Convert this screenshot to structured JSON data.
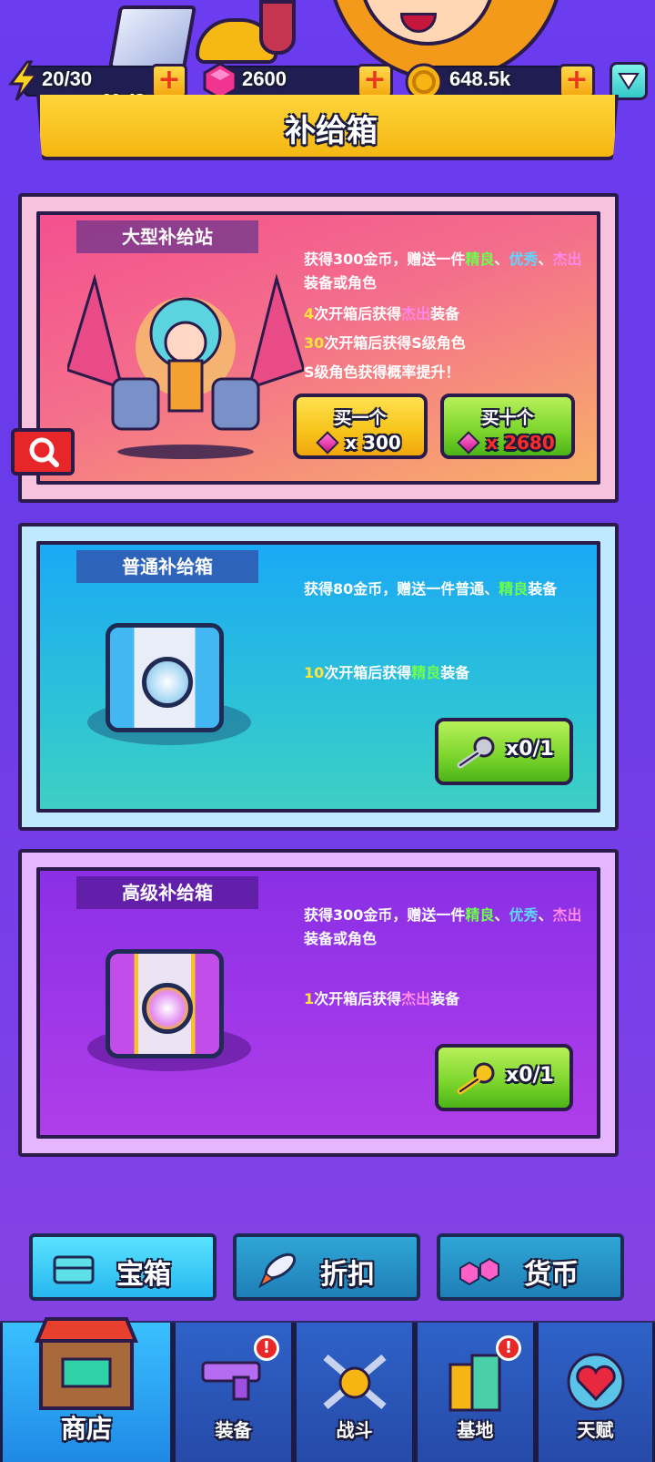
{
  "resources": {
    "energy": "20/30",
    "timer": "09:42",
    "gems": "2600",
    "coins": "648.5k",
    "plus_label": "+"
  },
  "header": {
    "title": "补给箱"
  },
  "cards": {
    "big": {
      "title": "大型补给站",
      "line1_a": "获得300金币，赠送一件",
      "line1_b": "精良",
      "line1_c": "、",
      "line1_d": "优秀",
      "line1_e": "、",
      "line1_f": "杰出",
      "line1_g": "装备或角色",
      "line2_a": "4",
      "line2_b": "次开箱后获得",
      "line2_c": "杰出",
      "line2_d": "装备",
      "line3_a": "30",
      "line3_b": "次开箱后获得S级角色",
      "line4": "S级角色获得概率提升！",
      "buy_one_label": "买一个",
      "buy_one_price": "x 300",
      "buy_ten_label": "买十个",
      "buy_ten_price": "x 2680"
    },
    "normal": {
      "title": "普通补给箱",
      "line1_a": "获得80金币，赠送一件普通、",
      "line1_b": "精良",
      "line1_c": "装备",
      "line2_a": "10",
      "line2_b": "次开箱后获得",
      "line2_c": "精良",
      "line2_d": "装备",
      "key_count": "x0/1"
    },
    "advanced": {
      "title": "高级补给箱",
      "line1_a": "获得300金币，赠送一件",
      "line1_b": "精良",
      "line1_c": "、",
      "line1_d": "优秀",
      "line1_e": "、",
      "line1_f": "杰出",
      "line1_g": "装备或角色",
      "line2_a": "1",
      "line2_b": "次开箱后获得",
      "line2_c": "杰出",
      "line2_d": "装备",
      "key_count": "x0/1"
    }
  },
  "sub_tabs": [
    {
      "label": "宝箱"
    },
    {
      "label": "折扣"
    },
    {
      "label": "货币"
    }
  ],
  "nav": [
    {
      "label": "商店"
    },
    {
      "label": "装备"
    },
    {
      "label": "战斗"
    },
    {
      "label": "基地"
    },
    {
      "label": "天赋"
    }
  ],
  "alert_mark": "!"
}
